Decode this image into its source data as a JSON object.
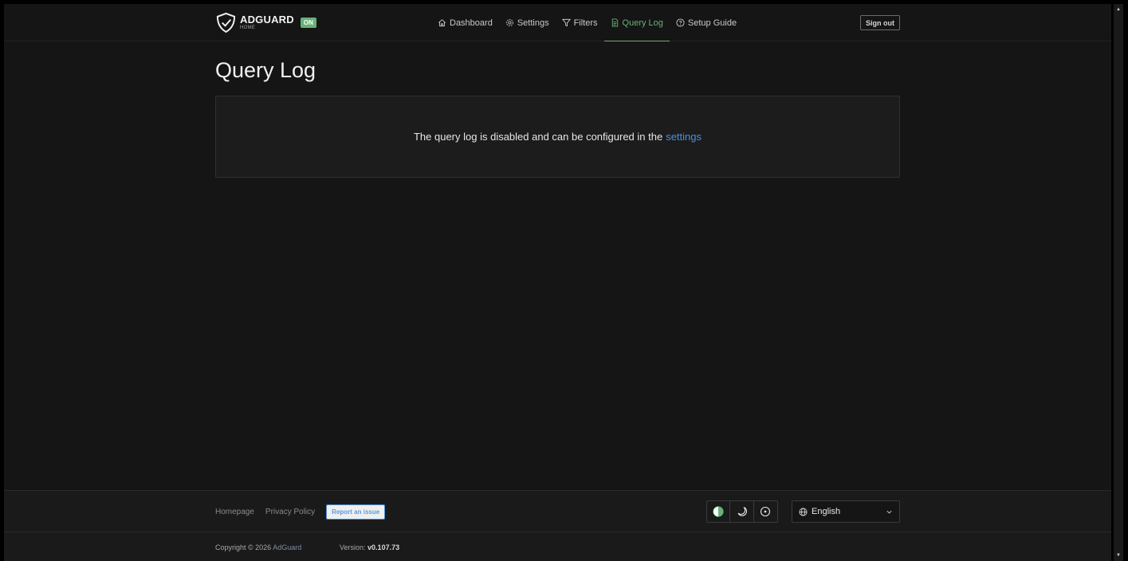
{
  "header": {
    "logo_name": "ADGUARD",
    "logo_sub": "HOME",
    "status_badge": "ON",
    "nav": [
      {
        "label": "Dashboard",
        "icon": "home-icon"
      },
      {
        "label": "Settings",
        "icon": "gear-icon"
      },
      {
        "label": "Filters",
        "icon": "filter-icon"
      },
      {
        "label": "Query Log",
        "icon": "document-icon",
        "active": true
      },
      {
        "label": "Setup Guide",
        "icon": "help-icon"
      }
    ],
    "signout_label": "Sign out"
  },
  "main": {
    "title": "Query Log",
    "message": "The query log is disabled and can be configured in the",
    "message_link": "settings"
  },
  "footer": {
    "links": [
      "Homepage",
      "Privacy Policy"
    ],
    "report_label": "Report an issue",
    "theme_options": [
      "contrast-icon",
      "moon-icon",
      "sun-icon"
    ],
    "language": "English",
    "copyright_prefix": "Copyright © 2026",
    "copyright_brand": "AdGuard",
    "version_label": "Version:",
    "version_value": "v0.107.73"
  },
  "colors": {
    "accent": "#67b279",
    "link": "#4d8fdb",
    "background": "#151515"
  }
}
